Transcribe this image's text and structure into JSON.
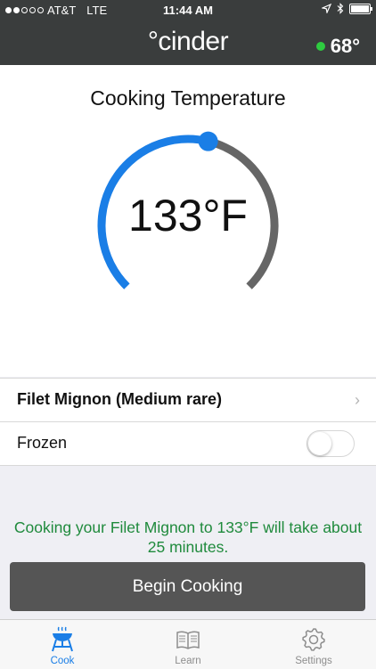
{
  "status_bar": {
    "carrier": "AT&T",
    "network": "LTE",
    "time": "11:44 AM"
  },
  "header": {
    "logo": "°cinder",
    "ambient_temp": "68°"
  },
  "main": {
    "title": "Cooking Temperature",
    "temperature": "133°F",
    "dial_fraction": 0.55
  },
  "settings": {
    "food": {
      "label": "Filet Mignon (Medium rare)",
      "chevron": "›"
    },
    "frozen": {
      "label": "Frozen",
      "enabled": false
    }
  },
  "info_text": "Cooking your Filet Mignon to 133°F will take about 25 minutes.",
  "begin_button": "Begin Cooking",
  "tabs": [
    {
      "label": "Cook",
      "icon": "grill-icon"
    },
    {
      "label": "Learn",
      "icon": "book-icon"
    },
    {
      "label": "Settings",
      "icon": "gear-icon"
    }
  ],
  "colors": {
    "accent": "#1a7ee6",
    "header": "#3a3d3d",
    "info": "#1f8a3c",
    "dial_track": "#666666",
    "button": "#555555"
  }
}
